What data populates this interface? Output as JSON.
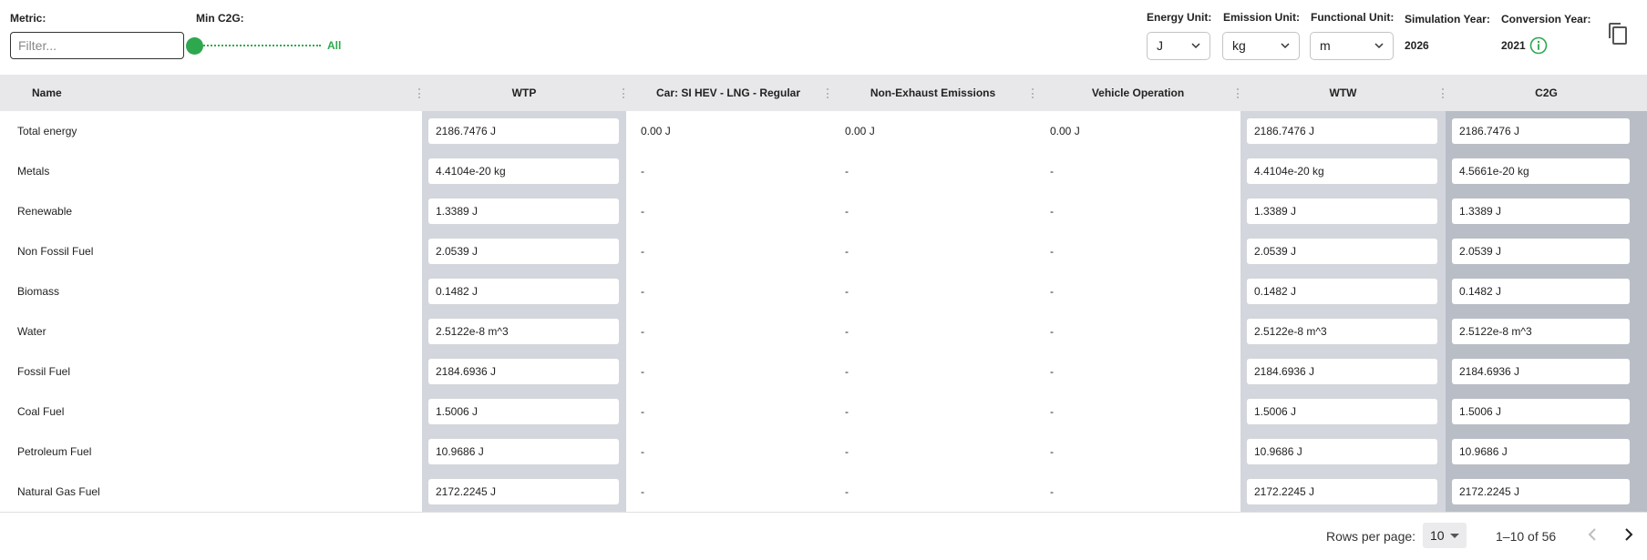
{
  "filters": {
    "metric_label": "Metric:",
    "filter_placeholder": "Filter...",
    "min_c2g_label": "Min C2G:",
    "min_c2g_value": "All",
    "energy_unit_label": "Energy Unit:",
    "energy_unit_value": "J",
    "emission_unit_label": "Emission Unit:",
    "emission_unit_value": "kg",
    "functional_unit_label": "Functional Unit:",
    "functional_unit_value": "m",
    "simulation_year_label": "Simulation Year:",
    "simulation_year_value": "2026",
    "conversion_year_label": "Conversion Year:",
    "conversion_year_value": "2021"
  },
  "icons": {
    "info": "info-circle-icon",
    "copy": "copy-icon",
    "chevron": "chevron-down-icon",
    "prev": "chevron-left-icon",
    "next": "chevron-right-icon"
  },
  "colors": {
    "accent_green": "#2ea84f",
    "header_bg": "#e8e8ea",
    "highlight_col": "#d3d6dc",
    "c2g_col": "#b9bdc6"
  },
  "table": {
    "columns": [
      "Name",
      "WTP",
      "Car: SI HEV - LNG - Regular",
      "Non-Exhaust Emissions",
      "Vehicle Operation",
      "WTW",
      "C2G"
    ],
    "rows": [
      [
        "Total energy",
        "2186.7476 J",
        "0.00 J",
        "0.00 J",
        "0.00 J",
        "2186.7476 J",
        "2186.7476 J"
      ],
      [
        "Metals",
        "4.4104e-20 kg",
        "-",
        "-",
        "-",
        "4.4104e-20 kg",
        "4.5661e-20 kg"
      ],
      [
        "Renewable",
        "1.3389 J",
        "-",
        "-",
        "-",
        "1.3389 J",
        "1.3389 J"
      ],
      [
        "Non Fossil Fuel",
        "2.0539 J",
        "-",
        "-",
        "-",
        "2.0539 J",
        "2.0539 J"
      ],
      [
        "Biomass",
        "0.1482 J",
        "-",
        "-",
        "-",
        "0.1482 J",
        "0.1482 J"
      ],
      [
        "Water",
        "2.5122e-8 m^3",
        "-",
        "-",
        "-",
        "2.5122e-8 m^3",
        "2.5122e-8 m^3"
      ],
      [
        "Fossil Fuel",
        "2184.6936 J",
        "-",
        "-",
        "-",
        "2184.6936 J",
        "2184.6936 J"
      ],
      [
        "Coal Fuel",
        "1.5006 J",
        "-",
        "-",
        "-",
        "1.5006 J",
        "1.5006 J"
      ],
      [
        "Petroleum Fuel",
        "10.9686 J",
        "-",
        "-",
        "-",
        "10.9686 J",
        "10.9686 J"
      ],
      [
        "Natural Gas Fuel",
        "2172.2245 J",
        "-",
        "-",
        "-",
        "2172.2245 J",
        "2172.2245 J"
      ]
    ]
  },
  "pagination": {
    "rows_per_page_label": "Rows per page:",
    "rows_per_page_value": "10",
    "range_text": "1–10 of 56"
  }
}
